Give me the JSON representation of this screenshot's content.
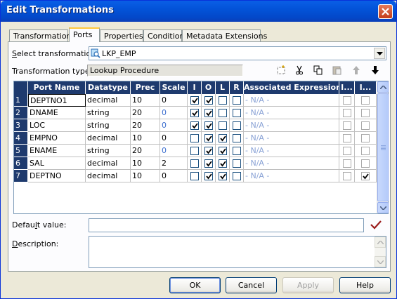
{
  "window": {
    "title": "Edit Transformations"
  },
  "tabs": [
    {
      "label": "Transformation"
    },
    {
      "label": "Ports"
    },
    {
      "label": "Properties"
    },
    {
      "label": "Condition"
    },
    {
      "label": "Metadata Extensions"
    }
  ],
  "active_tab": "Ports",
  "select_transformation": {
    "label_pre": "",
    "label_u": "S",
    "label_post": "elect transformation:",
    "value": "LKP_EMP"
  },
  "transformation_type": {
    "label": "Transformation type:",
    "value": "Lookup Procedure"
  },
  "toolbar_icons": [
    "new-port-icon",
    "cut-icon",
    "copy-icon",
    "paste-icon",
    "move-up-icon",
    "move-down-icon"
  ],
  "grid": {
    "headers": [
      "Port Name",
      "Datatype",
      "Prec",
      "Scale",
      "I",
      "O",
      "L",
      "R",
      "Associated Expression",
      "I...",
      "I..."
    ],
    "rows": [
      {
        "n": "1",
        "name": "DEPTNO1",
        "type": "decimal",
        "prec": "10",
        "scale": "0",
        "scale_blue": false,
        "I": true,
        "O": true,
        "L": false,
        "R": false,
        "expr": "- N/A -",
        "c1": false,
        "c2": false
      },
      {
        "n": "2",
        "name": "DNAME",
        "type": "string",
        "prec": "20",
        "scale": "0",
        "scale_blue": true,
        "I": true,
        "O": true,
        "L": false,
        "R": false,
        "expr": "- N/A -",
        "c1": false,
        "c2": false
      },
      {
        "n": "3",
        "name": "LOC",
        "type": "string",
        "prec": "20",
        "scale": "0",
        "scale_blue": true,
        "I": true,
        "O": true,
        "L": false,
        "R": false,
        "expr": "- N/A -",
        "c1": false,
        "c2": false
      },
      {
        "n": "4",
        "name": "EMPNO",
        "type": "decimal",
        "prec": "10",
        "scale": "0",
        "scale_blue": false,
        "I": false,
        "O": true,
        "L": true,
        "R": false,
        "expr": "- N/A -",
        "c1": false,
        "c2": false
      },
      {
        "n": "5",
        "name": "ENAME",
        "type": "string",
        "prec": "20",
        "scale": "0",
        "scale_blue": true,
        "I": false,
        "O": true,
        "L": true,
        "R": false,
        "expr": "- N/A -",
        "c1": false,
        "c2": false
      },
      {
        "n": "6",
        "name": "SAL",
        "type": "decimal",
        "prec": "10",
        "scale": "2",
        "scale_blue": false,
        "I": false,
        "O": true,
        "L": true,
        "R": false,
        "expr": "- N/A -",
        "c1": false,
        "c2": false
      },
      {
        "n": "7",
        "name": "DEPTNO",
        "type": "decimal",
        "prec": "10",
        "scale": "0",
        "scale_blue": false,
        "I": false,
        "O": true,
        "L": true,
        "R": false,
        "expr": "- N/A -",
        "c1": false,
        "c2": true
      }
    ]
  },
  "default_value": {
    "label_pre": "Defau",
    "label_u": "l",
    "label_post": "t value:",
    "value": ""
  },
  "description": {
    "label_pre": "",
    "label_u": "D",
    "label_post": "escription:",
    "value": ""
  },
  "buttons": {
    "ok": "OK",
    "cancel": "Cancel",
    "apply": "Apply",
    "help": "Help"
  },
  "colors": {
    "title_bar": "#0353d8",
    "grid_header": "#1e3a6e",
    "accent_tab": "#ffc83c",
    "validate_check": "#9b1c1c"
  }
}
